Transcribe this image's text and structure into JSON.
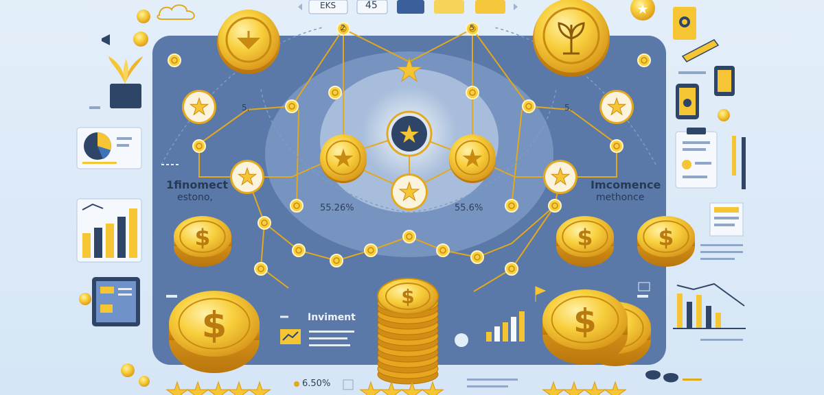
{
  "colors": {
    "board": "#5b79a8",
    "board_dark": "#4f6c9b",
    "gold": "#f5c534",
    "gold_dark": "#d99a16",
    "gold_light": "#ffe48a",
    "connector": "#e2a91e",
    "background": "#e3eef9",
    "accent_blue": "#2f5d9e"
  },
  "header": {
    "tab_left_text": "EKS",
    "tab_mid_text": "45"
  },
  "labels": {
    "left_title_line1": "1finomect",
    "left_title_line2": "estono,",
    "right_title_line1": "Imcomence",
    "right_title_line2": "methonce",
    "center_pct_left": "55.26%",
    "center_pct_right": "55.6%",
    "bottom_label": "Inviment",
    "bottom_pct": "6.50%",
    "node_left_value": "5.",
    "node_right_value": "5.",
    "node_top_left_value": "2",
    "node_top_right_value": "5"
  },
  "icons": {
    "coin_symbol": "$",
    "star_symbol": "★"
  },
  "rating": {
    "left_stars": 5,
    "mid_stars": 4,
    "right_stars": 4
  }
}
